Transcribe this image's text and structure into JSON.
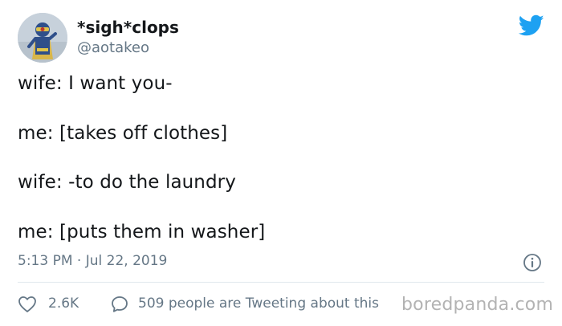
{
  "author": {
    "display_name": "*sigh*clops",
    "handle": "@aotakeo",
    "avatar_icon": "cyclops-avatar-icon"
  },
  "brand": {
    "icon": "twitter-bird-icon",
    "color": "#1da1f2"
  },
  "tweet": {
    "lines": [
      "wife: I want you-",
      "me: [takes off clothes]",
      "wife: -to do the laundry",
      "me: [puts them in washer]"
    ],
    "timestamp": "5:13 PM · Jul 22, 2019"
  },
  "actions": {
    "like_icon": "heart-icon",
    "like_count": "2.6K",
    "comment_icon": "comment-icon",
    "tweeting_text": "509 people are Tweeting about this",
    "info_icon": "info-icon"
  },
  "watermark": {
    "text": "boredpanda.com"
  },
  "colors": {
    "text": "#14171a",
    "secondary": "#657786",
    "divider": "#e1e8ed"
  }
}
